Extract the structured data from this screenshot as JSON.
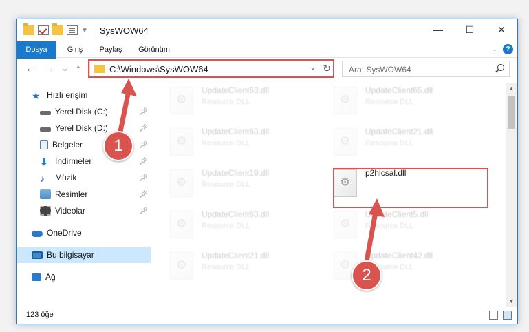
{
  "window": {
    "title": "SysWOW64",
    "controls": {
      "minimize": "—",
      "maximize": "☐",
      "close": "✕"
    }
  },
  "ribbon": {
    "tabs": [
      "Dosya",
      "Giriş",
      "Paylaş",
      "Görünüm"
    ],
    "help_label": "?"
  },
  "nav": {
    "back": "←",
    "forward": "→",
    "recent": "⌄",
    "up": "↑",
    "address": "C:\\Windows\\SysWOW64",
    "search_placeholder": "Ara: SysWOW64"
  },
  "sidebar": {
    "items": [
      {
        "label": "Hızlı erişim",
        "icon": "star-icon",
        "color": "#2b79c9"
      },
      {
        "label": "Yerel Disk (C:)",
        "icon": "drive-icon",
        "color": "#555555",
        "pinned": true
      },
      {
        "label": "Yerel Disk (D:)",
        "icon": "drive-icon",
        "color": "#555555",
        "pinned": true
      },
      {
        "label": "Belgeler",
        "icon": "documents-icon",
        "color": "#5a7fa8",
        "pinned": true
      },
      {
        "label": "İndirmeler",
        "icon": "downloads-icon",
        "color": "#2b79c9",
        "pinned": true
      },
      {
        "label": "Müzik",
        "icon": "music-icon",
        "color": "#2b79c9",
        "pinned": true
      },
      {
        "label": "Resimler",
        "icon": "pictures-icon",
        "color": "#4a90c8",
        "pinned": true
      },
      {
        "label": "Videolar",
        "icon": "videos-icon",
        "color": "#444444",
        "pinned": true
      },
      {
        "label": "OneDrive",
        "icon": "cloud-icon",
        "color": "#2b79c9"
      },
      {
        "label": "Bu bilgisayar",
        "icon": "computer-icon",
        "color": "#3a8ad8",
        "selected": true
      },
      {
        "label": "Ağ",
        "icon": "network-icon",
        "color": "#2b79c9"
      }
    ]
  },
  "files": [
    {
      "name": "UpdateClient63.dll",
      "type": "Resource DLL"
    },
    {
      "name": "UpdateClient65.dll",
      "type": "Resource DLL"
    },
    {
      "name": "UpdateClient63.dll",
      "type": "Resource DLL"
    },
    {
      "name": "UpdateClient21.dll",
      "type": "Resource DLL"
    },
    {
      "name": "UpdateClient19.dll",
      "type": "Resource DLL"
    },
    {
      "name": "p2hlcsal.dll",
      "type": ""
    },
    {
      "name": "UpdateClient63.dll",
      "type": "Resource DLL"
    },
    {
      "name": "UpdateClient5.dll",
      "type": "Resource DLL"
    },
    {
      "name": "UpdateClient21.dll",
      "type": "Resource DLL"
    },
    {
      "name": "UpdateClient42.dll",
      "type": "Resource DLL"
    }
  ],
  "status": {
    "count": "123 öğe"
  },
  "annotations": {
    "step1": "1",
    "step2": "2",
    "color": "#d9534f"
  }
}
